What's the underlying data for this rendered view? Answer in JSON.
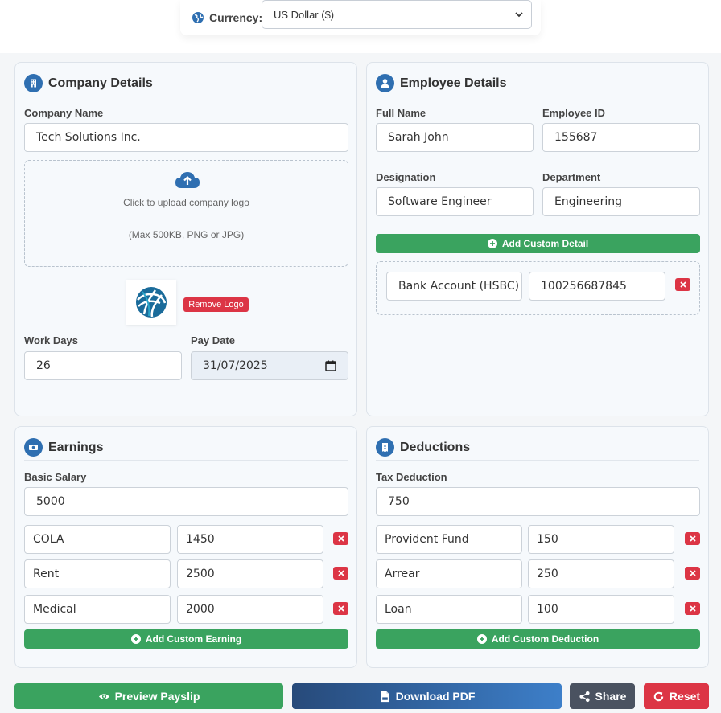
{
  "currency": {
    "label": "Currency:",
    "selected": "US Dollar ($)"
  },
  "company": {
    "title": "Company Details",
    "name_label": "Company Name",
    "name_value": "Tech Solutions Inc.",
    "upload_text": "Click to upload company logo",
    "upload_hint": "(Max 500KB, PNG or JPG)",
    "remove_logo": "Remove Logo",
    "work_days_label": "Work Days",
    "work_days_value": "26",
    "pay_date_label": "Pay Date",
    "pay_date_value": "31/07/2025"
  },
  "employee": {
    "title": "Employee Details",
    "full_name_label": "Full Name",
    "full_name_value": "Sarah John",
    "id_label": "Employee ID",
    "id_value": "155687",
    "designation_label": "Designation",
    "designation_value": "Software Engineer",
    "department_label": "Department",
    "department_value": "Engineering",
    "add_custom_detail": "Add Custom Detail",
    "custom_details": [
      {
        "key": "Bank Account (HSBC)",
        "value": "100256687845"
      }
    ]
  },
  "earnings": {
    "title": "Earnings",
    "basic_label": "Basic Salary",
    "basic_value": "5000",
    "items": [
      {
        "name": "COLA",
        "amount": "1450"
      },
      {
        "name": "Rent",
        "amount": "2500"
      },
      {
        "name": "Medical",
        "amount": "2000"
      }
    ],
    "add_button": "Add Custom Earning"
  },
  "deductions": {
    "title": "Deductions",
    "tax_label": "Tax Deduction",
    "tax_value": "750",
    "items": [
      {
        "name": "Provident Fund",
        "amount": "150"
      },
      {
        "name": "Arrear",
        "amount": "250"
      },
      {
        "name": "Loan",
        "amount": "100"
      }
    ],
    "add_button": "Add Custom Deduction"
  },
  "actions": {
    "preview": "Preview Payslip",
    "download": "Download PDF",
    "share": "Share",
    "reset": "Reset"
  },
  "colors": {
    "primary": "#2f6fb1",
    "success": "#3aa35f",
    "danger": "#dc3545",
    "dark": "#4a5260"
  }
}
